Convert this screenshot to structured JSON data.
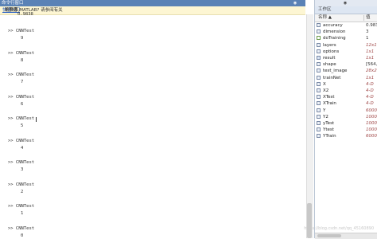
{
  "command_window": {
    "title": "命令行窗口",
    "banner_prefix": "不熟悉 MATLAB? 请参阅有关",
    "banner_link": "快速入门",
    "banner_suffix": "的资源。",
    "partial_output": "0.9838",
    "lines": [
      ">> CNNTest",
      "9",
      ">> CNNTest",
      "8",
      ">> CNNTest",
      "7",
      ">> CNNTest",
      "6",
      ">> CNNTest",
      "5",
      ">> CNNTest",
      "4",
      ">> CNNTest",
      "3",
      ">> CNNTest",
      "2",
      ">> CNNTest",
      "1",
      ">> CNNTest",
      "0"
    ]
  },
  "workspace": {
    "title": "工作区",
    "col_name": "名称 ▲",
    "col_value": "值",
    "variables": [
      {
        "name": "accuracy",
        "value": "0.983",
        "icon": "numeric-icon"
      },
      {
        "name": "dimension",
        "value": "3",
        "icon": "numeric-icon"
      },
      {
        "name": "doTraining",
        "value": "1",
        "icon": "logical-icon"
      },
      {
        "name": "layers",
        "value": "12x1",
        "icon": "array-icon"
      },
      {
        "name": "options",
        "value": "1x1",
        "icon": "object-icon"
      },
      {
        "name": "result",
        "value": "1x1",
        "icon": "struct-icon"
      },
      {
        "name": "shape",
        "value": "[564,6",
        "icon": "numeric-icon"
      },
      {
        "name": "test_image",
        "value": "28x28",
        "icon": "numeric-icon"
      },
      {
        "name": "trainNet",
        "value": "1x1",
        "icon": "object-icon"
      },
      {
        "name": "X",
        "value": "4-D",
        "icon": "numeric-icon"
      },
      {
        "name": "X2",
        "value": "4-D",
        "icon": "numeric-icon"
      },
      {
        "name": "XTest",
        "value": "4-D",
        "icon": "numeric-icon"
      },
      {
        "name": "XTrain",
        "value": "4-D",
        "icon": "numeric-icon"
      },
      {
        "name": "Y",
        "value": "6000x",
        "icon": "numeric-icon"
      },
      {
        "name": "Y2",
        "value": "1000x",
        "icon": "numeric-icon"
      },
      {
        "name": "yTest",
        "value": "1000x",
        "icon": "numeric-icon"
      },
      {
        "name": "Ytest",
        "value": "1000x",
        "icon": "numeric-icon"
      },
      {
        "name": "YTrain",
        "value": "6000x",
        "icon": "numeric-icon"
      }
    ]
  },
  "watermark": "https://blog.csdn.net/qq_45160890"
}
